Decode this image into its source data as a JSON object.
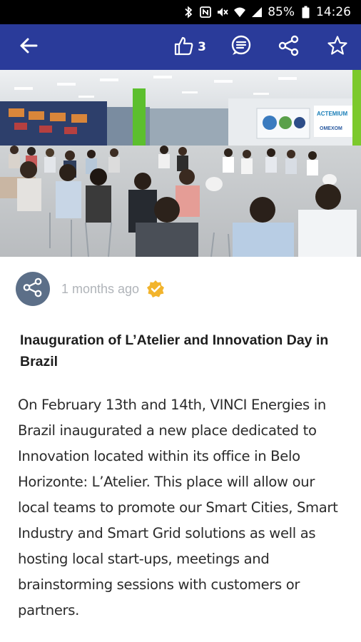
{
  "status_bar": {
    "battery": "85%",
    "time": "14:26",
    "icons": [
      "bluetooth-icon",
      "nfc-icon",
      "mute-icon",
      "wifi-icon",
      "signal-icon",
      "battery-icon"
    ]
  },
  "app_bar": {
    "background_color": "#2a3b9a",
    "like_count": "3",
    "icons": [
      "back-arrow-icon",
      "thumbs-up-icon",
      "comment-icon",
      "share-icon",
      "star-icon"
    ]
  },
  "hero_image": {
    "screen_text": [
      "ACTEMIUM",
      "OMEXOM"
    ]
  },
  "post_meta": {
    "time_ago": "1 months ago",
    "verified_color": "#f2b42c",
    "avatar_icon": "share-icon"
  },
  "article": {
    "title": "Inauguration of L’Atelier and Innovation Day in Brazil",
    "body": "On February 13th and 14th, VINCI Energies in Brazil inaugurated a new place dedicated to Innovation located within its office in Belo Horizonte: L’Atelier. This place will allow our local teams to promote our Smart Cities, Smart Industry and Smart Grid solutions as well as hosting local start-ups, meetings and brainstorming sessions with customers or partners."
  }
}
